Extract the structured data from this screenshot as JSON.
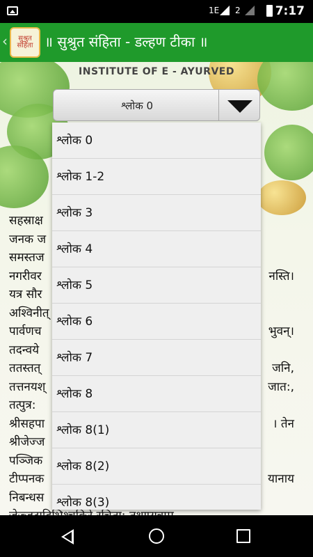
{
  "status_bar": {
    "network_1": "1E",
    "network_2": "2",
    "time": "7:17"
  },
  "app_bar": {
    "back_glyph": "‹",
    "logo_text": "सुश्रुत संहिता",
    "title": "॥ सुश्रुत संहिता - डल्हण टीका ॥"
  },
  "header": {
    "institute": "INSTITUTE OF E - AYURVED"
  },
  "spinner": {
    "selected": "श्लोक 0"
  },
  "dropdown_items": [
    "श्लोक 0",
    "श्लोक 1-2",
    "श्लोक 3",
    "श्लोक 4",
    "श्लोक 5",
    "श्लोक 6",
    "श्लोक 7",
    "श्लोक 8",
    "श्लोक 8(1)",
    "श्लोक 8(2)",
    "श्लोक 8(3)"
  ],
  "body_text": [
    {
      "left": "सहस्राक्ष",
      "right": ""
    },
    {
      "left": "जनक ज",
      "right": ""
    },
    {
      "left": "समस्तज",
      "right": ""
    },
    {
      "left": "नगरीवर",
      "right": "नस्ति।"
    },
    {
      "left": "यत्र सौर",
      "right": ""
    },
    {
      "left": "अश्विनीत्",
      "right": ""
    },
    {
      "left": "पार्वणच",
      "right": "भुवन्।"
    },
    {
      "left": "तदन्वये",
      "right": ""
    },
    {
      "left": "ततस्तत्",
      "right": "जनि,"
    },
    {
      "left": "तत्तनयश्",
      "right": "जात:,"
    },
    {
      "left": "तत्पुत्र: ",
      "right": ""
    },
    {
      "left": "श्रीसहपा",
      "right": "। तेन"
    },
    {
      "left": "श्रीजेज्ज",
      "right": ""
    },
    {
      "left": "पञ्जिक",
      "right": ""
    },
    {
      "left": "टीप्पनक",
      "right": "यानाय"
    },
    {
      "left": "निबन्धस",
      "right": ""
    },
    {
      "left": "जेज्जटादिभिश्चक्रिरे रचिता: तथाप्यत्राम्",
      "right": ""
    }
  ]
}
